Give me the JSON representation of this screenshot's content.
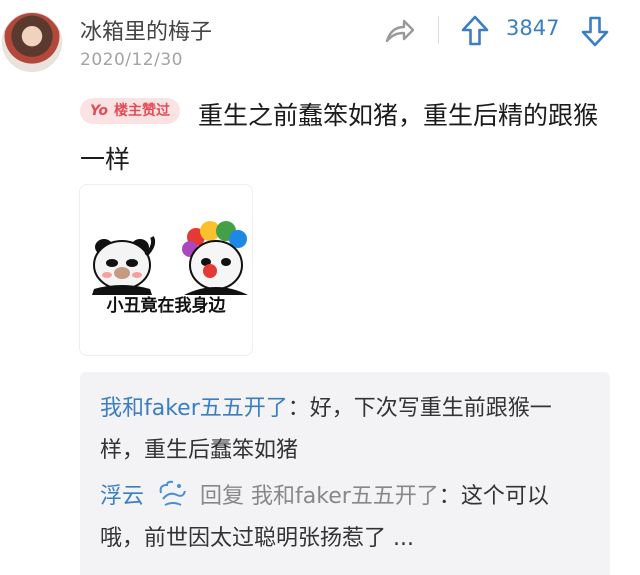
{
  "comment": {
    "username": "冰箱里的梅子",
    "date": "2020/12/30",
    "score": "3847",
    "badge": {
      "prefix": "Yo",
      "label": "楼主赞过"
    },
    "text": "重生之前蠢笨如猪，重生后精的跟猴一样",
    "sticker_caption": "小丑竟在我身边"
  },
  "replies": [
    {
      "user": "我和faker五五开了",
      "separator": "：",
      "text": "好，下次写重生前跟猴一样，重生后蠢笨如猪"
    },
    {
      "user": "浮云",
      "reply_word": "回复",
      "reply_to": "我和faker五五开了",
      "separator": "：",
      "text": "这个可以哦，前世因太过聪明张扬惹了 ..."
    }
  ],
  "icons": {
    "share": "share-arrow-icon",
    "upvote": "arrow-up-icon",
    "downvote": "arrow-down-icon",
    "reply_user_icon": "cloud-swirl-icon"
  },
  "colors": {
    "accent": "#3a7ec4",
    "badge_bg": "#fbe3e3",
    "badge_text": "#e14d57"
  }
}
